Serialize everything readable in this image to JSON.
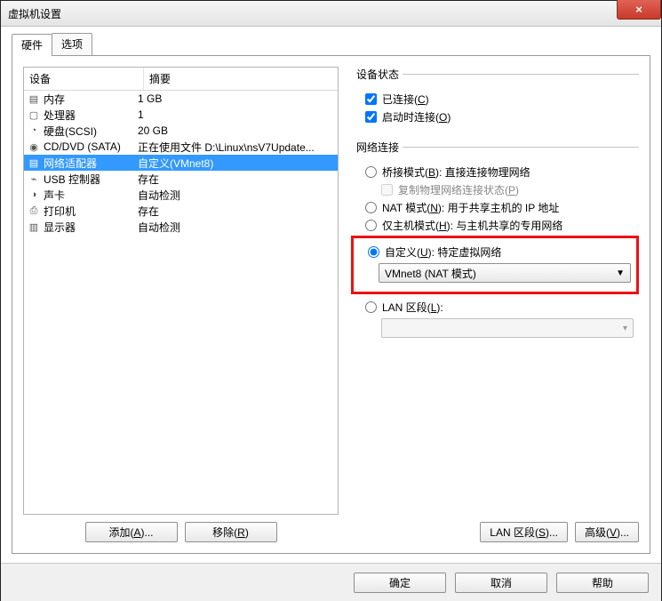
{
  "window": {
    "title": "虚拟机设置"
  },
  "close_label": "×",
  "tabs": {
    "hardware": "硬件",
    "options": "选项"
  },
  "list": {
    "col_device": "设备",
    "col_summary": "摘要",
    "rows": [
      {
        "icon": "▤",
        "name": "内存",
        "summary": "1 GB"
      },
      {
        "icon": "▢",
        "name": "处理器",
        "summary": "1"
      },
      {
        "icon": "◔",
        "name": "硬盘(SCSI)",
        "summary": "20 GB"
      },
      {
        "icon": "◉",
        "name": "CD/DVD (SATA)",
        "summary": "正在使用文件 D:\\Linux\\nsV7Update..."
      },
      {
        "icon": "▤",
        "name": "网络适配器",
        "summary": "自定义(VMnet8)"
      },
      {
        "icon": "⌁",
        "name": "USB 控制器",
        "summary": "存在"
      },
      {
        "icon": "◑",
        "name": "声卡",
        "summary": "自动检测"
      },
      {
        "icon": "⎙",
        "name": "打印机",
        "summary": "存在"
      },
      {
        "icon": "▥",
        "name": "显示器",
        "summary": "自动检测"
      }
    ],
    "selected_index": 4
  },
  "buttons": {
    "add": "添加(A)...",
    "remove": "移除(R)",
    "lan_seg": "LAN 区段(S)...",
    "advanced": "高级(V)...",
    "ok": "确定",
    "cancel": "取消",
    "help": "帮助"
  },
  "device_status": {
    "legend": "设备状态",
    "connected": "已连接(C)",
    "connect_at_power": "启动时连接(O)"
  },
  "network": {
    "legend": "网络连接",
    "bridged": "桥接模式(B): 直接连接物理网络",
    "replicate": "复制物理网络连接状态(P)",
    "nat": "NAT 模式(N): 用于共享主机的 IP 地址",
    "hostonly": "仅主机模式(H): 与主机共享的专用网络",
    "custom": "自定义(U): 特定虚拟网络",
    "custom_value": "VMnet8 (NAT 模式)",
    "lan": "LAN 区段(L):",
    "lan_value": ""
  }
}
